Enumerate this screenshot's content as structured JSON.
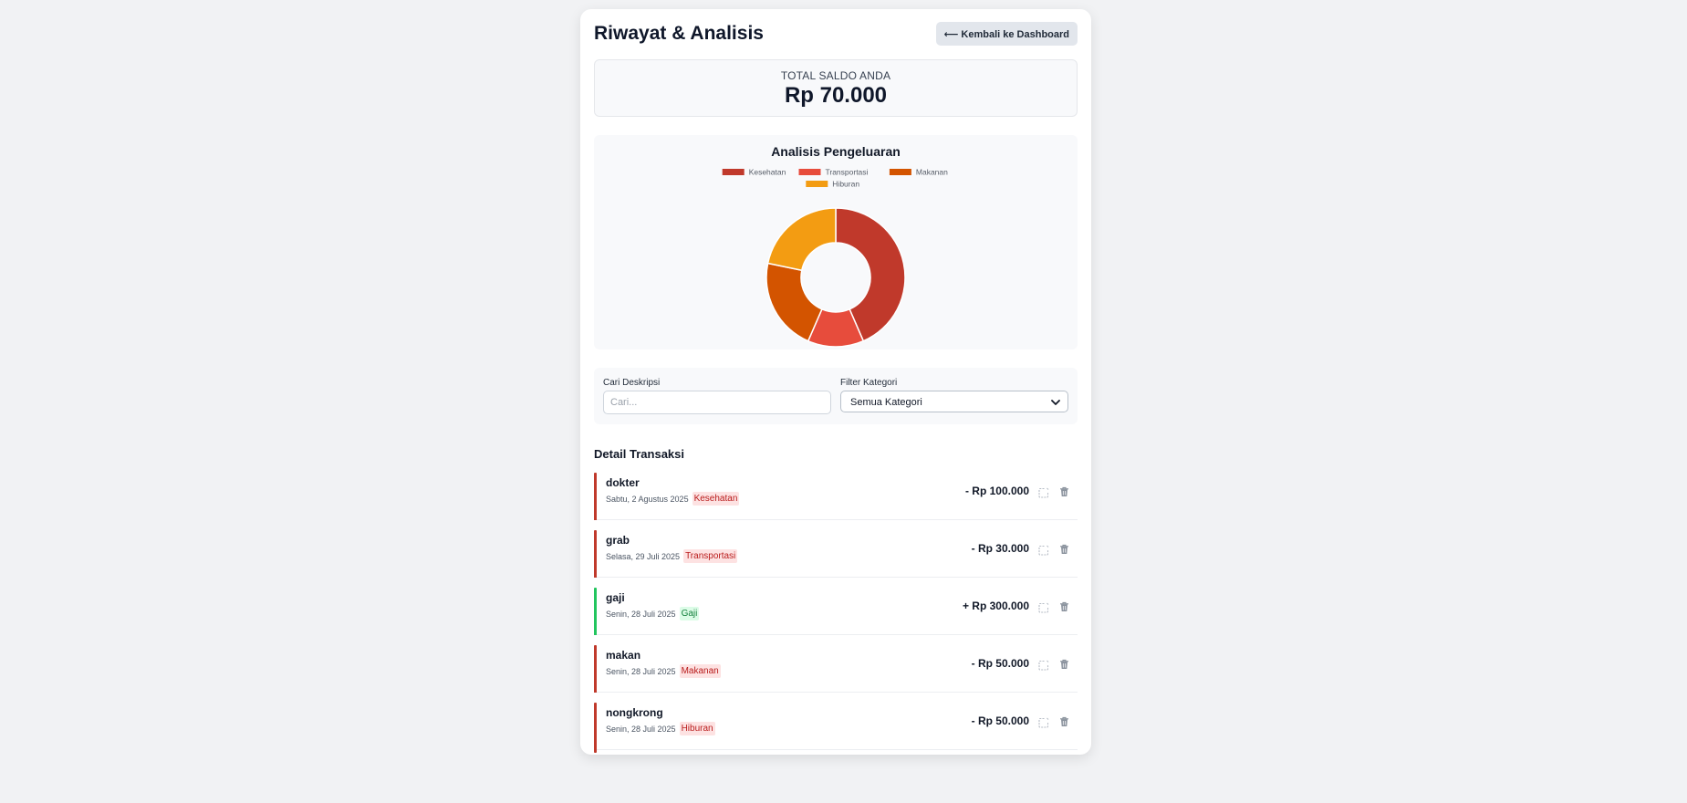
{
  "header": {
    "title": "Riwayat & Analisis",
    "back_label": "⟵ Kembali ke Dashboard"
  },
  "balance": {
    "label": "TOTAL SALDO ANDA",
    "value": "Rp 70.000"
  },
  "chart_title": "Analisis Pengeluaran",
  "chart_data": {
    "type": "pie",
    "variant": "doughnut",
    "legend_position": "top",
    "categories": [
      "Kesehatan",
      "Transportasi",
      "Makanan",
      "Hiburan"
    ],
    "values": [
      100000,
      30000,
      50000,
      50000
    ],
    "colors": [
      "#c0392b",
      "#e74c3c",
      "#d35400",
      "#f39c12"
    ]
  },
  "filters": {
    "search_label": "Cari Deskripsi",
    "search_placeholder": "Cari...",
    "category_label": "Filter Kategori",
    "category_value": "Semua Kategori"
  },
  "transactions_title": "Detail Transaksi",
  "transactions": [
    {
      "title": "dokter",
      "date": "Sabtu, 2 Agustus 2025",
      "category": "Kesehatan",
      "amount": "- Rp 100.000",
      "type": "expense"
    },
    {
      "title": "grab",
      "date": "Selasa, 29 Juli 2025",
      "category": "Transportasi",
      "amount": "- Rp 30.000",
      "type": "expense"
    },
    {
      "title": "gaji",
      "date": "Senin, 28 Juli 2025",
      "category": "Gaji",
      "amount": "+ Rp 300.000",
      "type": "income"
    },
    {
      "title": "makan",
      "date": "Senin, 28 Juli 2025",
      "category": "Makanan",
      "amount": "- Rp 50.000",
      "type": "expense"
    },
    {
      "title": "nongkrong",
      "date": "Senin, 28 Juli 2025",
      "category": "Hiburan",
      "amount": "- Rp 50.000",
      "type": "expense"
    }
  ],
  "colors": {
    "expense": "#c0392b",
    "income": "#22c55e",
    "icon": "#9ca3af"
  },
  "icons": {
    "edit": "edit-icon",
    "delete": "trash-icon",
    "select": "chevron-down-icon"
  }
}
